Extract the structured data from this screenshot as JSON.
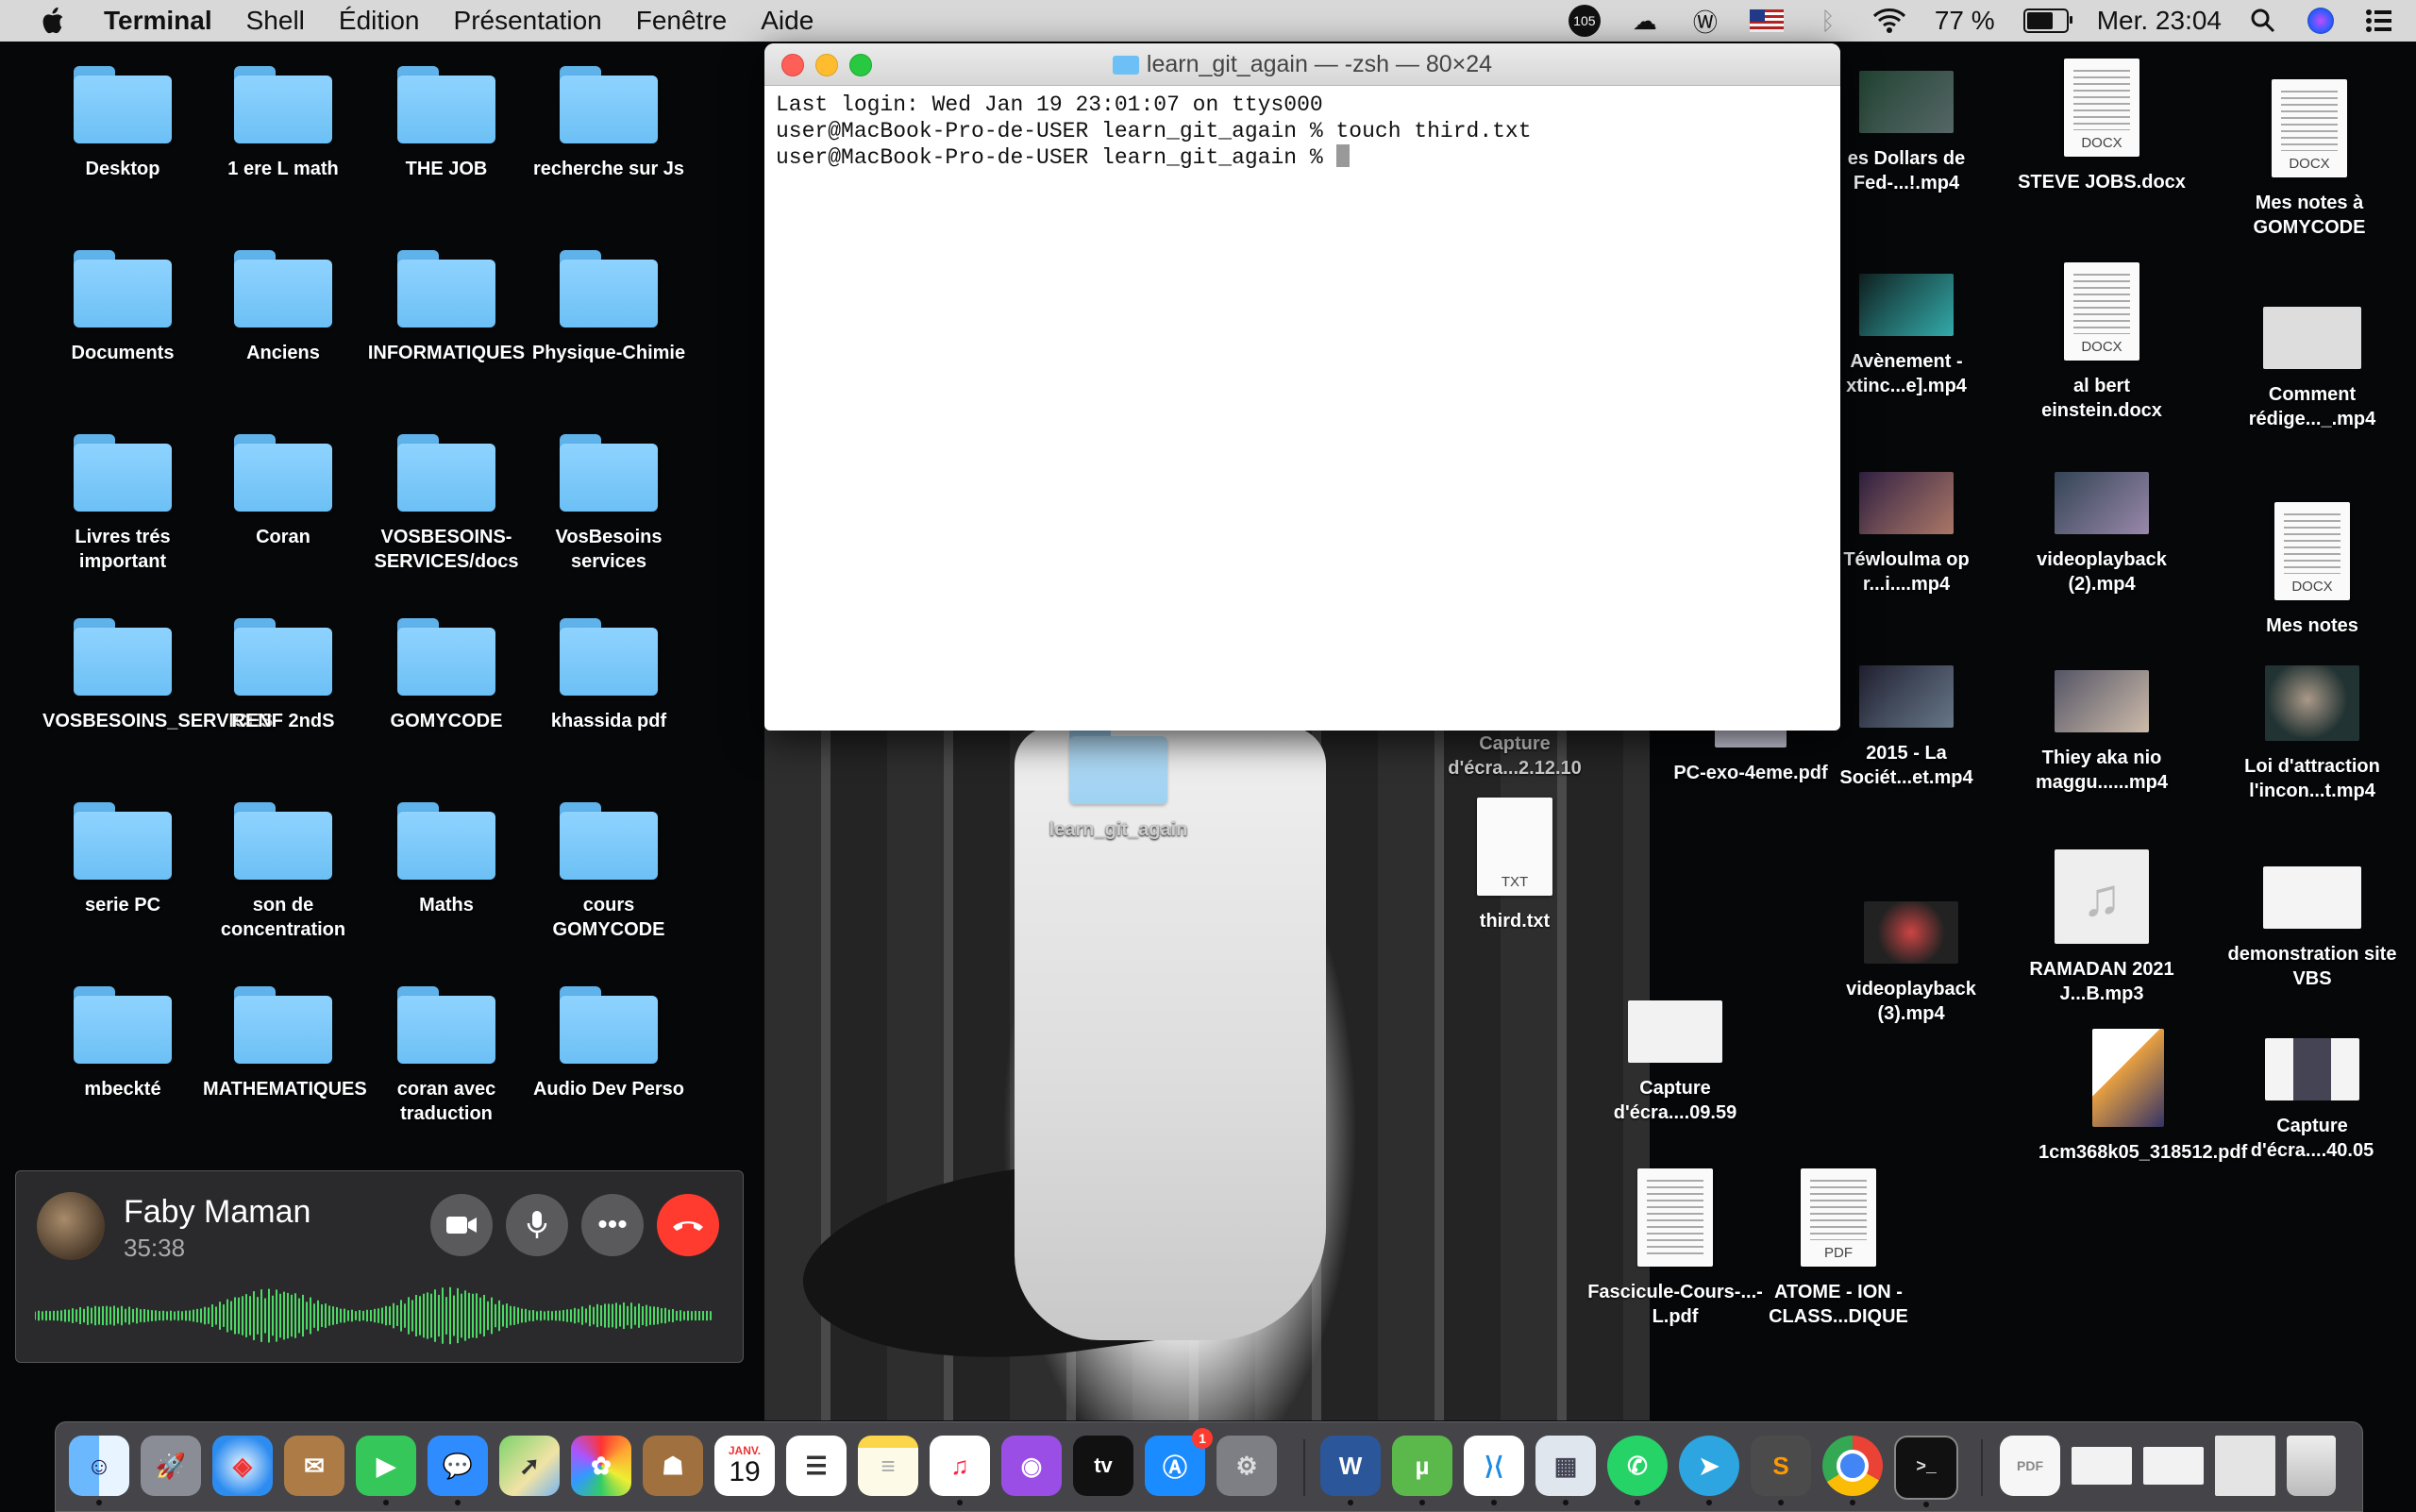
{
  "menubar": {
    "app_name": "Terminal",
    "items": [
      "Shell",
      "Édition",
      "Présentation",
      "Fenêtre",
      "Aide"
    ],
    "status": {
      "badge_count": "105",
      "battery_percent": "77 %",
      "battery_level": 0.77,
      "datetime": "Mer. 23:04"
    }
  },
  "desktop_folders": [
    "Desktop",
    "1 ere L math",
    "THE JOB",
    "recherche sur Js",
    "Documents",
    "Anciens",
    "INFORMATIQUES",
    "Physique-Chimie",
    "Livres trés important",
    "Coran",
    "VOSBESOINS-SERVICES/docs",
    "VosBesoins services",
    "VOSBESOINS_SERVICES",
    "RENF 2ndS",
    "GOMYCODE",
    "khassida pdf",
    "serie PC",
    "son de concentration",
    "Maths",
    "cours GOMYCODE",
    "mbeckté",
    "MATHEMATIQUES",
    "coran avec traduction",
    "Audio Dev Perso"
  ],
  "terminal": {
    "title": "learn_git_again — -zsh — 80×24",
    "lines": [
      "Last login: Wed Jan 19 23:01:07 on ttys000",
      "user@MacBook-Pro-de-USER learn_git_again % touch third.txt",
      "user@MacBook-Pro-de-USER learn_git_again % "
    ]
  },
  "desktop_files": {
    "learn_git_again": "learn_git_again",
    "capture_1": "Capture d'écra...2.12.10",
    "third_txt": "third.txt",
    "third_kind": "TXT",
    "pc_exo": "PC-exo-4eme.pdf",
    "capture_2": "Capture d'écra....09.59",
    "fascicule": "Fascicule-Cours-...-L.pdf",
    "atome": "ATOME - ION - CLASS...DIQUE",
    "atome_kind": "PDF",
    "dollars": "es Dollars de Fed-...!.mp4",
    "avenement": "Avènement - xtinc...e].mp4",
    "tewloulma": "Téwloulma op r...i....mp4",
    "societe": "2015 - La Sociét...et.mp4",
    "videoplayback3": "videoplayback (3).mp4",
    "steve_jobs": "STEVE JOBS.docx",
    "albert": "al bert einstein.docx",
    "videoplayback2": "videoplayback (2).mp4",
    "thiey": "Thiey aka nio maggu......mp4",
    "ramadan": "RAMADAN 2021 J...B.mp3",
    "cm368": "1cm368k05_318512.pdf",
    "mes_notes_gomy": "Mes notes à GOMYCODE",
    "comment": "Comment rédige..._.mp4",
    "mes_notes": "Mes notes",
    "loi": "Loi d'attraction l'incon...t.mp4",
    "demonstration": "demonstration site VBS",
    "capture_3": "Capture d'écra....40.05",
    "docx_kind": "DOCX"
  },
  "call": {
    "name": "Faby Maman",
    "duration": "35:38"
  },
  "dock": {
    "calendar_month": "JANV.",
    "calendar_day": "19",
    "appstore_badge": "1",
    "tv_label": "tv"
  }
}
